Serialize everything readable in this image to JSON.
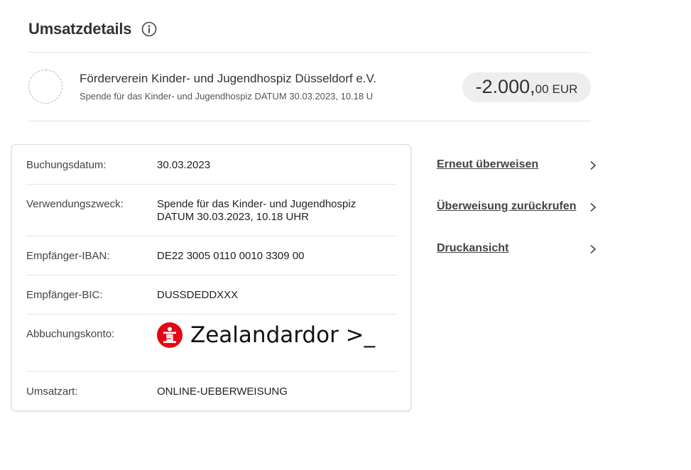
{
  "header": {
    "title": "Umsatzdetails",
    "info_icon": "info-circle-icon"
  },
  "transaction": {
    "avatar_icon": "empty-avatar-placeholder",
    "name": "Förderverein Kinder- und Jugendhospiz Düsseldorf e.V.",
    "subtitle": "Spende für das Kinder- und Jugendhospiz DATUM 30.03.2023, 10.18 U",
    "amount_main": "-2.000,",
    "amount_cents": "00",
    "currency": "EUR"
  },
  "details": [
    {
      "label": "Buchungsdatum:",
      "value": "30.03.2023"
    },
    {
      "label": "Verwendungszweck:",
      "value_line1": "Spende für das Kinder- und Jugendhospiz",
      "value_line2": "DATUM 30.03.2023, 10.18 UHR"
    },
    {
      "label": "Empfänger-IBAN:",
      "value": "DE22 3005 0110 0010 3309 00"
    },
    {
      "label": "Empfänger-BIC:",
      "value": "DUSSDEDDXXX"
    },
    {
      "label": "Abbuchungskonto:",
      "account_name": "Zealandardor >_",
      "logo_icon": "sparkasse-logo-icon"
    },
    {
      "label": "Umsatzart:",
      "value": "ONLINE-UEBERWEISUNG"
    }
  ],
  "actions": [
    {
      "label": "Erneut überweisen",
      "icon": "chevron-right-icon"
    },
    {
      "label": "Überweisung zurückrufen",
      "icon": "chevron-right-icon"
    },
    {
      "label": "Druckansicht",
      "icon": "chevron-right-icon"
    }
  ],
  "colors": {
    "brand_red": "#e30613",
    "text": "#333333",
    "pill_bg": "#eeeeee",
    "divider": "#e3e3e3"
  }
}
